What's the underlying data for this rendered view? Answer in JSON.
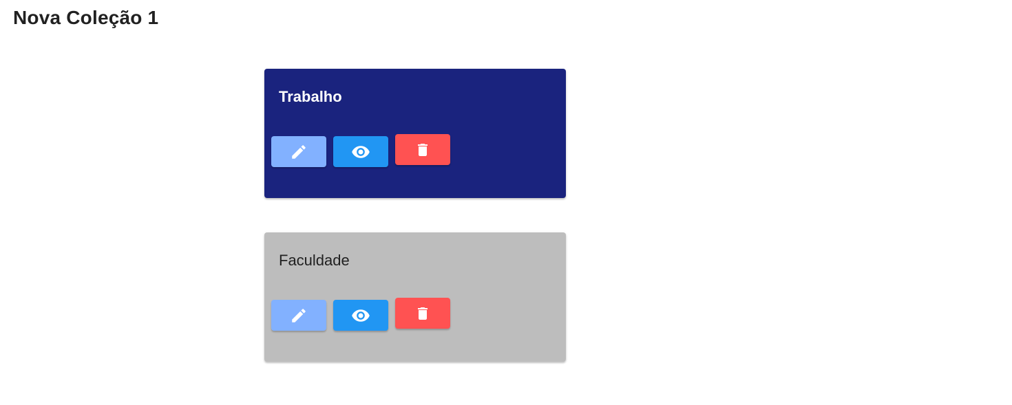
{
  "page": {
    "title": "Nova Coleção 1"
  },
  "collections": [
    {
      "name": "Trabalho",
      "background": "#1a237e",
      "text_color": "#ffffff",
      "actions": {
        "edit": "pencil-icon",
        "view": "eye-icon",
        "delete": "trash-icon"
      }
    },
    {
      "name": "Faculdade",
      "background": "#bdbdbd",
      "text_color": "#212121",
      "actions": {
        "edit": "pencil-icon",
        "view": "eye-icon",
        "delete": "trash-icon"
      }
    }
  ],
  "colors": {
    "edit_button": "#82b1ff",
    "view_button": "#2196f3",
    "delete_button": "#ff5252",
    "icon": "#ffffff"
  }
}
